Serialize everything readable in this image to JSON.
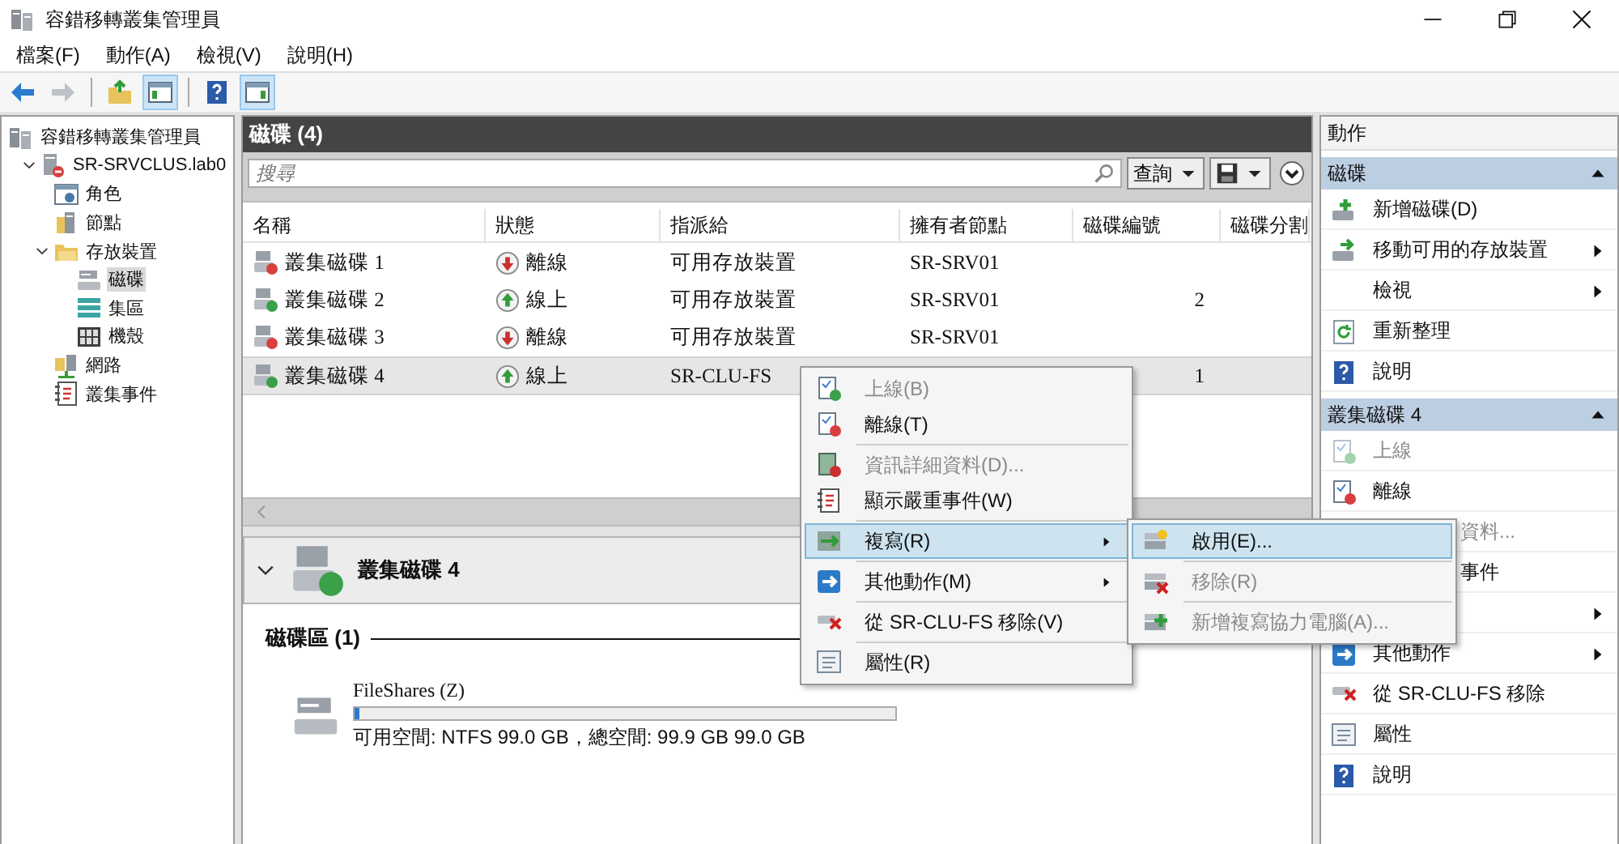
{
  "window": {
    "title": "容錯移轉叢集管理員"
  },
  "menu_bar": [
    "檔案(F)",
    "動作(A)",
    "檢視(V)",
    "說明(H)"
  ],
  "toolbar": [
    {
      "kind": "back",
      "pressed": false,
      "disabled": false
    },
    {
      "kind": "forward",
      "pressed": false,
      "disabled": true
    },
    {
      "kind": "separator"
    },
    {
      "kind": "up",
      "pressed": false,
      "disabled": false
    },
    {
      "kind": "console_tree",
      "pressed": true,
      "disabled": false
    },
    {
      "kind": "separator"
    },
    {
      "kind": "help",
      "pressed": false,
      "disabled": false
    },
    {
      "kind": "action_pane",
      "pressed": true,
      "disabled": false
    }
  ],
  "tree": [
    {
      "label": "容錯移轉叢集管理員",
      "selected": false,
      "children": [
        {
          "label": "SR-SRVCLUS.lab0",
          "selected": false,
          "expanded": true,
          "children": [
            {
              "label": "角色",
              "selected": false
            },
            {
              "label": "節點",
              "selected": false
            },
            {
              "label": "存放裝置",
              "selected": false,
              "expanded": true,
              "children": [
                {
                  "label": "磁碟",
                  "selected": true
                },
                {
                  "label": "集區",
                  "selected": false
                },
                {
                  "label": "機殼",
                  "selected": false
                }
              ]
            },
            {
              "label": "網路",
              "selected": false
            },
            {
              "label": "叢集事件",
              "selected": false
            }
          ]
        }
      ]
    }
  ],
  "disks_panel": {
    "title": "磁碟 (4)",
    "search": {
      "placeholder": "搜尋"
    },
    "query_button": "查詢",
    "columns": [
      "名稱",
      "狀態",
      "指派給",
      "擁有者節點",
      "磁碟編號",
      "磁碟分割"
    ],
    "rows": [
      {
        "name": "叢集磁碟 1",
        "online": false,
        "status": "離線",
        "assigned_to": "可用存放裝置",
        "owner_node": "SR-SRV01",
        "selected": false
      },
      {
        "name": "叢集磁碟 2",
        "online": true,
        "status": "線上",
        "assigned_to": "可用存放裝置",
        "owner_node": "SR-SRV01",
        "disk_number": "2",
        "selected": false
      },
      {
        "name": "叢集磁碟 3",
        "online": false,
        "status": "離線",
        "assigned_to": "可用存放裝置",
        "owner_node": "SR-SRV01",
        "selected": false
      },
      {
        "name": "叢集磁碟 4",
        "online": true,
        "status": "線上",
        "assigned_to": "SR-CLU-FS",
        "disk_number": "1",
        "selected": true
      }
    ]
  },
  "details": {
    "title": "叢集磁碟 4",
    "expanded": true,
    "volumes_heading": "磁碟區 (1)",
    "volume": {
      "name": "FileShares (Z)",
      "level": 0.01,
      "info": "可用空間: NTFS 99.0 GB，總空間: 99.9 GB 99.0 GB"
    }
  },
  "context_menu": {
    "items": [
      {
        "kind": "item",
        "label": "上線(B)",
        "disabled": true,
        "selected": false,
        "submenu": false
      },
      {
        "kind": "item",
        "label": "離線(T)",
        "disabled": false,
        "selected": false,
        "submenu": false
      },
      {
        "kind": "separator"
      },
      {
        "kind": "item",
        "label": "資訊詳細資料(D)...",
        "disabled": true,
        "selected": false,
        "submenu": false
      },
      {
        "kind": "item",
        "label": "顯示嚴重事件(W)",
        "disabled": false,
        "selected": false,
        "submenu": false
      },
      {
        "kind": "separator"
      },
      {
        "kind": "item",
        "label": "複寫(R)",
        "disabled": false,
        "selected": true,
        "submenu": true
      },
      {
        "kind": "separator"
      },
      {
        "kind": "item",
        "label": "其他動作(M)",
        "disabled": false,
        "selected": false,
        "submenu": true
      },
      {
        "kind": "separator"
      },
      {
        "kind": "item",
        "label": "從 SR-CLU-FS 移除(V)",
        "disabled": false,
        "selected": false,
        "submenu": false
      },
      {
        "kind": "separator"
      },
      {
        "kind": "item",
        "label": "屬性(R)",
        "disabled": false,
        "selected": false,
        "submenu": false
      }
    ]
  },
  "submenu": {
    "items": [
      {
        "kind": "item",
        "label": "啟用(E)...",
        "disabled": false,
        "selected": true,
        "submenu": false
      },
      {
        "kind": "separator"
      },
      {
        "kind": "item",
        "label": "移除(R)",
        "disabled": true,
        "selected": false,
        "submenu": false
      },
      {
        "kind": "separator"
      },
      {
        "kind": "item",
        "label": "新增複寫協力電腦(A)...",
        "disabled": true,
        "selected": false,
        "submenu": false
      }
    ]
  },
  "actions_pane": {
    "title": "動作",
    "sections": [
      {
        "title": "磁碟",
        "expanded": true,
        "items": [
          {
            "kind": "full",
            "label": "新增磁碟(D)",
            "disabled": false,
            "submenu": false
          },
          {
            "kind": "full",
            "label": "移動可用的存放裝置",
            "disabled": false,
            "submenu": true
          },
          {
            "kind": "full",
            "label": "檢視",
            "disabled": false,
            "submenu": true
          },
          {
            "kind": "full",
            "label": "重新整理",
            "disabled": false,
            "submenu": false
          },
          {
            "kind": "full",
            "label": "說明",
            "disabled": false,
            "submenu": false
          }
        ]
      },
      {
        "title": "叢集磁碟 4",
        "expanded": true,
        "items": [
          {
            "kind": "full",
            "label": "上線",
            "disabled": true,
            "submenu": false
          },
          {
            "kind": "full",
            "label": "離線",
            "disabled": false,
            "submenu": false
          },
          {
            "kind": "partial",
            "label": "資料...",
            "disabled": true,
            "submenu": false
          },
          {
            "kind": "partial",
            "label": "事件",
            "disabled": false,
            "submenu": false
          },
          {
            "kind": "partial",
            "disabled": false,
            "submenu": true
          },
          {
            "kind": "full",
            "label": "其他動作",
            "disabled": false,
            "submenu": true
          },
          {
            "kind": "full",
            "label": "從 SR-CLU-FS 移除",
            "disabled": false,
            "submenu": false
          },
          {
            "kind": "full",
            "label": "屬性",
            "disabled": false,
            "submenu": false
          },
          {
            "kind": "full",
            "label": "說明",
            "disabled": false,
            "submenu": false
          }
        ]
      }
    ]
  }
}
